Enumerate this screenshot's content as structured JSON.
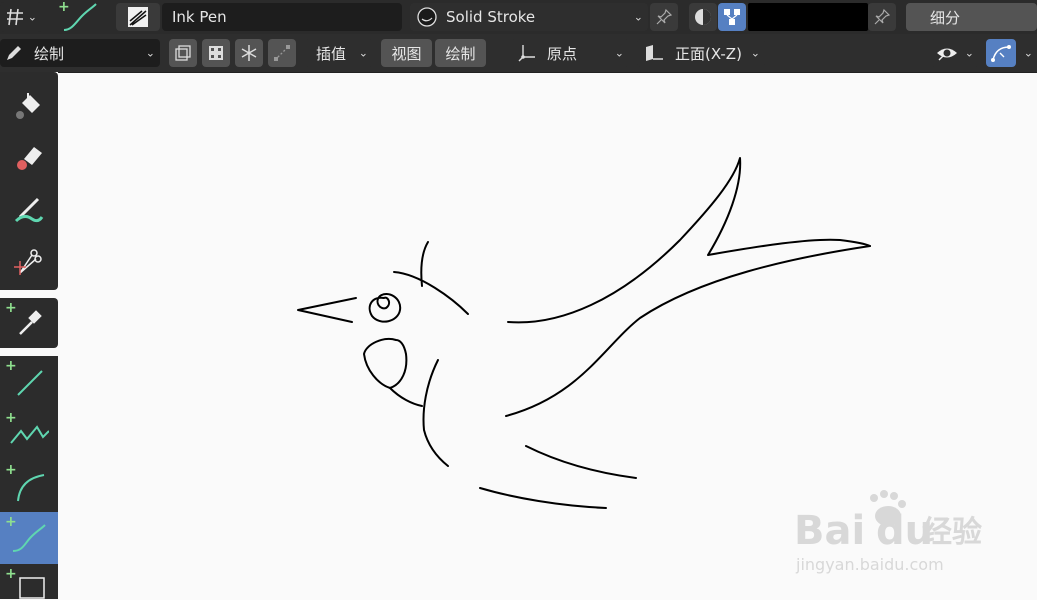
{
  "topbar": {
    "brush_name": "Ink Pen",
    "material_name": "Solid Stroke",
    "subdivide_label": "细分",
    "color_hex": "#000000"
  },
  "toolbar2": {
    "mode_label": "绘制",
    "interpolate_label": "插值",
    "view_label": "视图",
    "draw_label": "绘制",
    "origin_label": "原点",
    "plane_label": "正面(X-Z)"
  },
  "watermark": {
    "brand": "Bai",
    "brand2": "du",
    "suffix": "经验",
    "url": "jingyan.baidu.com"
  },
  "colors": {
    "accent": "#5680c2",
    "header": "#2b2b2b",
    "field": "#1d1d1d",
    "button": "#545454",
    "canvas": "#fafafa",
    "plus": "#8fe08f"
  },
  "icons": {
    "mode": "pencil-icon",
    "brush": "ink-pen-brush-icon",
    "material": "solid-stroke-material-icon",
    "pin": "pin-icon",
    "tools": [
      "fill-bucket-icon",
      "eraser-icon",
      "tint-brush-icon",
      "cutter-icon",
      "eyedropper-icon",
      "line-icon",
      "polyline-icon",
      "arc-icon",
      "curve-icon",
      "box-icon"
    ]
  }
}
